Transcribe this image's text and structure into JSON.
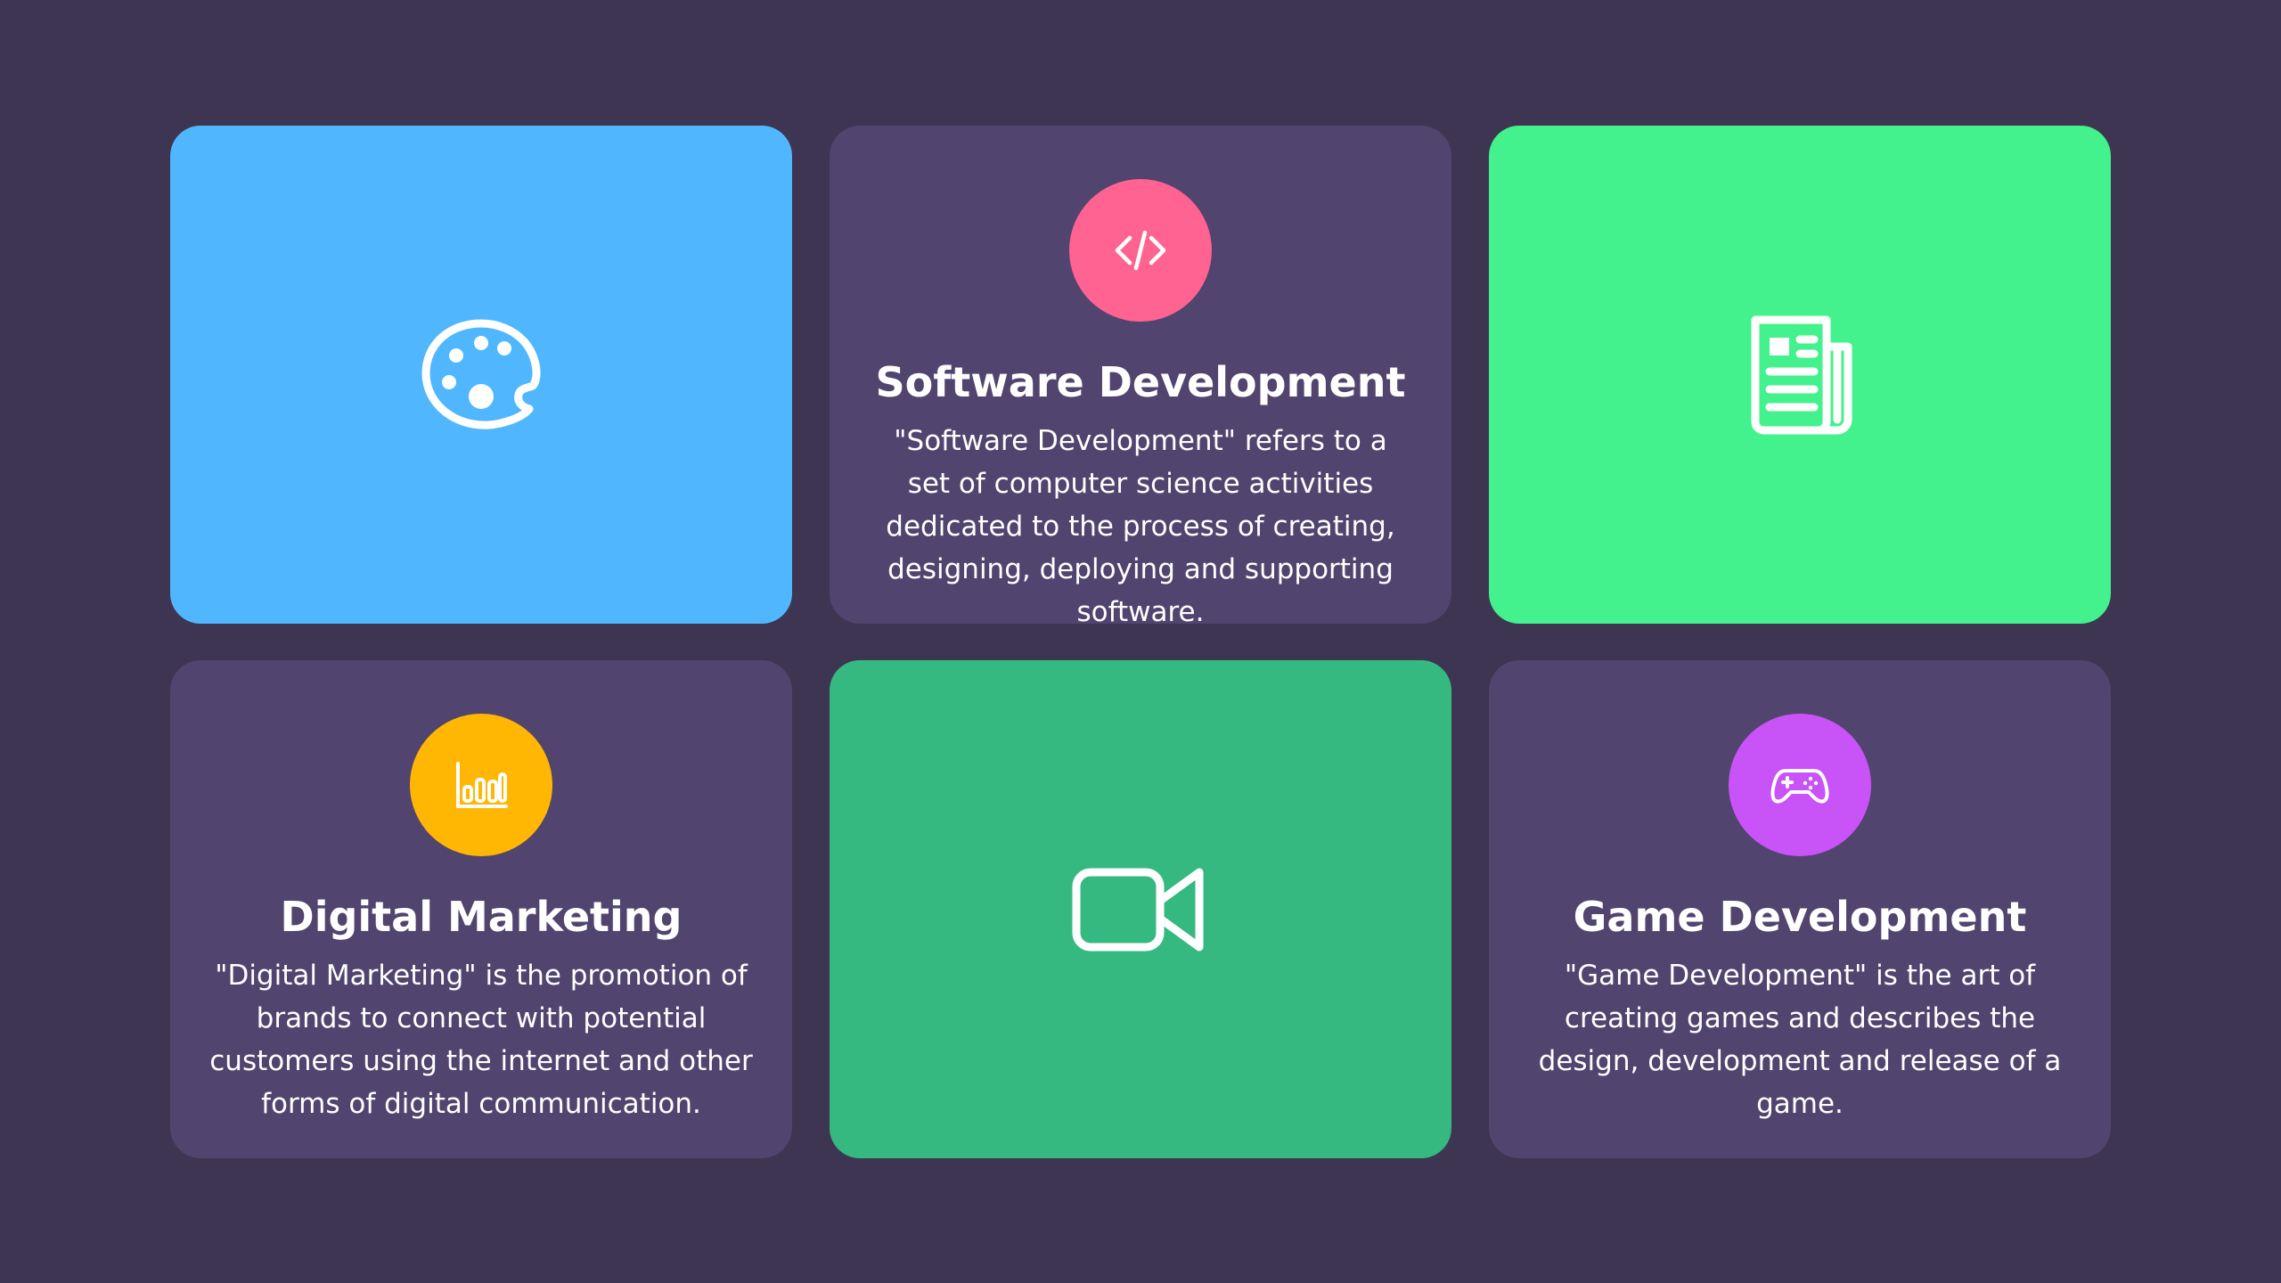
{
  "cards": [
    {
      "type": "icon",
      "icon": "palette-icon",
      "background": "#50b7ff"
    },
    {
      "type": "text",
      "icon": "code-icon",
      "circle_color": "#ff6392",
      "title": "Software Development",
      "description": "\"Software Development\" refers to a set of computer science activities dedicated to the process of creating, designing, deploying and supporting software."
    },
    {
      "type": "icon",
      "icon": "newspaper-icon",
      "background": "#43f28c"
    },
    {
      "type": "text",
      "icon": "bar-chart-icon",
      "circle_color": "#ffb703",
      "title": "Digital Marketing",
      "description": "\"Digital Marketing\" is the promotion of brands to connect with potential customers using the internet and other forms of digital communication."
    },
    {
      "type": "icon",
      "icon": "video-camera-icon",
      "background": "#36b981"
    },
    {
      "type": "text",
      "icon": "gamepad-icon",
      "circle_color": "#c853f6",
      "title": "Game Development",
      "description": "\"Game Development\" is the art of creating games and describes the design, development and release of a game."
    }
  ],
  "colors": {
    "page_background": "#3d3551",
    "text_card_background": "#51446e",
    "icon_stroke": "#ffffff"
  }
}
